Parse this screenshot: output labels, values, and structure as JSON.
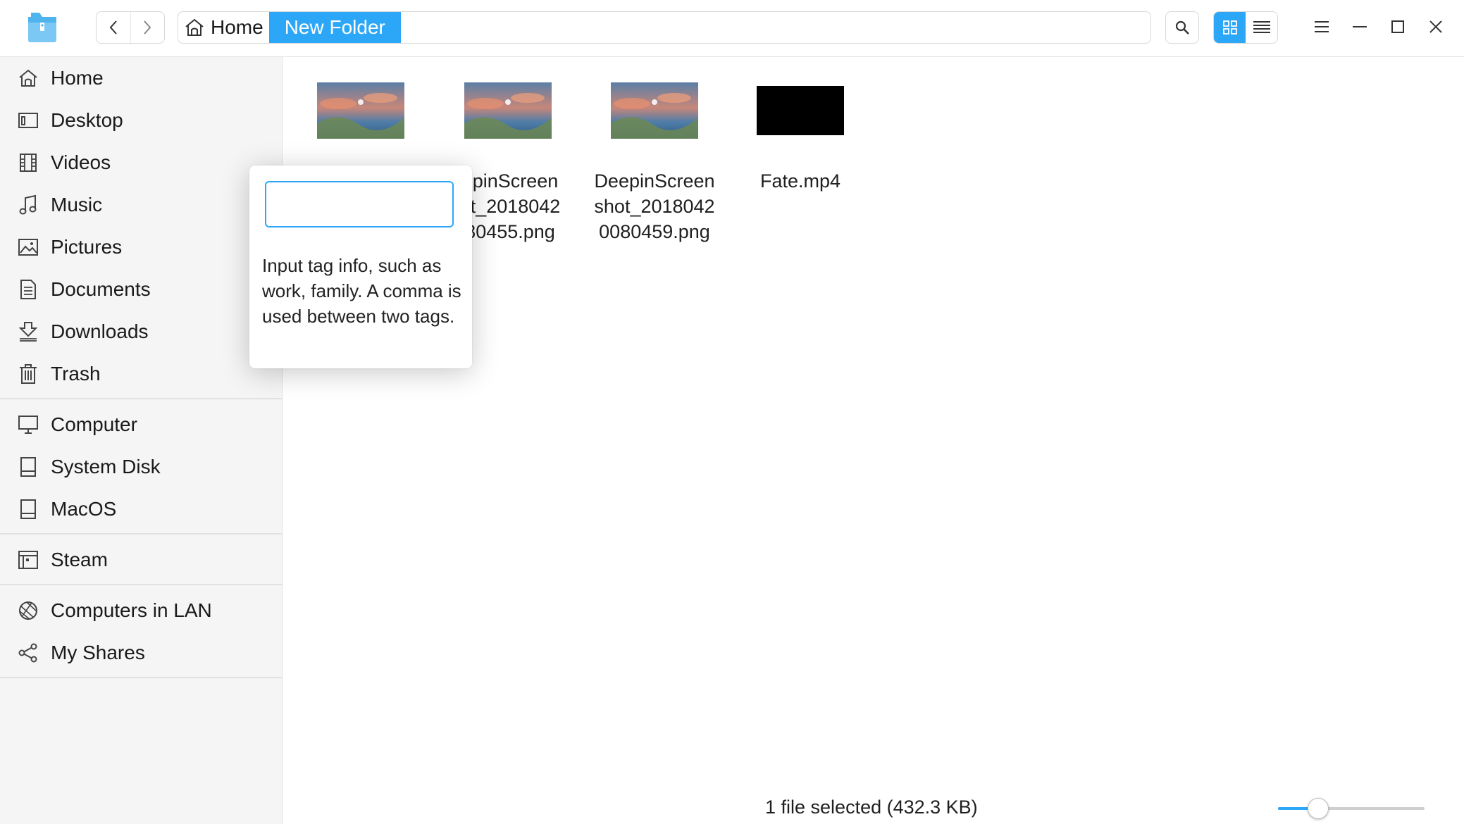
{
  "toolbar": {
    "back_icon": "chevron-left-icon",
    "forward_icon": "chevron-right-icon",
    "search_icon": "search-icon",
    "grid_view_icon": "grid-view-icon",
    "list_view_icon": "list-view-icon",
    "menu_icon": "menu-icon",
    "minimize_icon": "minimize-icon",
    "maximize_icon": "maximize-icon",
    "close_icon": "close-icon"
  },
  "breadcrumb": {
    "home_label": "Home",
    "current_label": "New Folder"
  },
  "sidebar": {
    "items": [
      {
        "label": "Home",
        "icon": "home-icon"
      },
      {
        "label": "Desktop",
        "icon": "desktop-icon"
      },
      {
        "label": "Videos",
        "icon": "videos-icon"
      },
      {
        "label": "Music",
        "icon": "music-icon"
      },
      {
        "label": "Pictures",
        "icon": "pictures-icon"
      },
      {
        "label": "Documents",
        "icon": "documents-icon"
      },
      {
        "label": "Downloads",
        "icon": "downloads-icon"
      },
      {
        "label": "Trash",
        "icon": "trash-icon"
      },
      {
        "label": "Computer",
        "icon": "computer-icon"
      },
      {
        "label": "System Disk",
        "icon": "disk-icon"
      },
      {
        "label": "MacOS",
        "icon": "disk-icon"
      },
      {
        "label": "Steam",
        "icon": "steam-drive-icon"
      },
      {
        "label": "Computers in LAN",
        "icon": "network-icon"
      },
      {
        "label": "My Shares",
        "icon": "share-icon"
      }
    ]
  },
  "files": [
    {
      "name_lines": [
        "",
        "",
        ""
      ],
      "thumb": "wallpaper"
    },
    {
      "name_lines": [
        "epinScreen",
        "ot_2018042",
        "80455.png"
      ],
      "thumb": "wallpaper"
    },
    {
      "name_lines": [
        "DeepinScreen",
        "shot_2018042",
        "0080459.png"
      ],
      "thumb": "wallpaper"
    },
    {
      "name_lines": [
        "Fate.mp4",
        "",
        ""
      ],
      "thumb": "video-black"
    }
  ],
  "tag_popup": {
    "input_value": "",
    "hint": "Input tag info, such as work, family. A comma is used between two tags."
  },
  "status": {
    "text": "1 file selected (432.3 KB)",
    "zoom_level": 0.27
  },
  "colors": {
    "accent": "#2ca7f8",
    "sidebar_bg": "#f5f5f5"
  }
}
